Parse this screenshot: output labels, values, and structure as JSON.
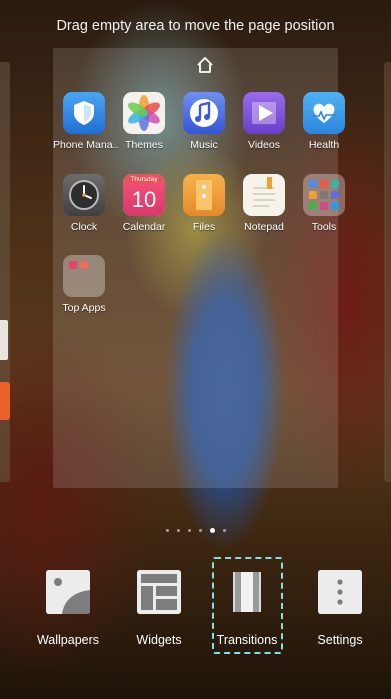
{
  "hint": "Drag empty area to move the page position",
  "apps": [
    {
      "label": "Phone Mana..",
      "icon": "phone-manager-icon"
    },
    {
      "label": "Themes",
      "icon": "themes-icon"
    },
    {
      "label": "Music",
      "icon": "music-icon"
    },
    {
      "label": "Videos",
      "icon": "videos-icon"
    },
    {
      "label": "Health",
      "icon": "health-icon"
    },
    {
      "label": "Clock",
      "icon": "clock-icon"
    },
    {
      "label": "Calendar",
      "icon": "calendar-icon",
      "day_name": "Thursday",
      "day_number": "10"
    },
    {
      "label": "Files",
      "icon": "files-icon"
    },
    {
      "label": "Notepad",
      "icon": "notepad-icon"
    },
    {
      "label": "Tools",
      "icon": "tools-folder-icon"
    },
    {
      "label": "Top Apps",
      "icon": "top-apps-folder-icon"
    }
  ],
  "page_indicator": {
    "count": 6,
    "active_index": 4
  },
  "toolbar": [
    {
      "label": "Wallpapers",
      "icon": "wallpapers-icon"
    },
    {
      "label": "Widgets",
      "icon": "widgets-icon"
    },
    {
      "label": "Transitions",
      "icon": "transitions-icon",
      "highlighted": true
    },
    {
      "label": "Settings",
      "icon": "settings-icon"
    }
  ],
  "colors": {
    "highlight": "#7ee2e2"
  }
}
